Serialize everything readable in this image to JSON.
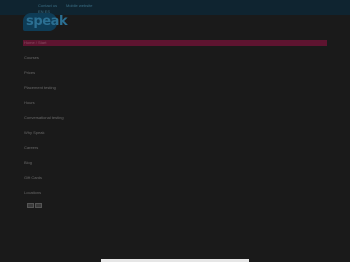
{
  "topbar": {
    "links": [
      "Contact us",
      "Mobile website"
    ],
    "languages": "EN  ES"
  },
  "logo": {
    "wordmark": "speak",
    "subtitle": ""
  },
  "menu": {
    "items": [
      {
        "label": "Home / Start"
      },
      {
        "label": "Courses"
      },
      {
        "label": "Prices"
      },
      {
        "label": "Placement testing"
      },
      {
        "label": "Hours"
      },
      {
        "label": "Conversational testing"
      },
      {
        "label": "Why Speak"
      },
      {
        "label": "Careers"
      },
      {
        "label": "Blog"
      },
      {
        "label": "Gift Cards"
      },
      {
        "label": "Locations"
      }
    ]
  }
}
